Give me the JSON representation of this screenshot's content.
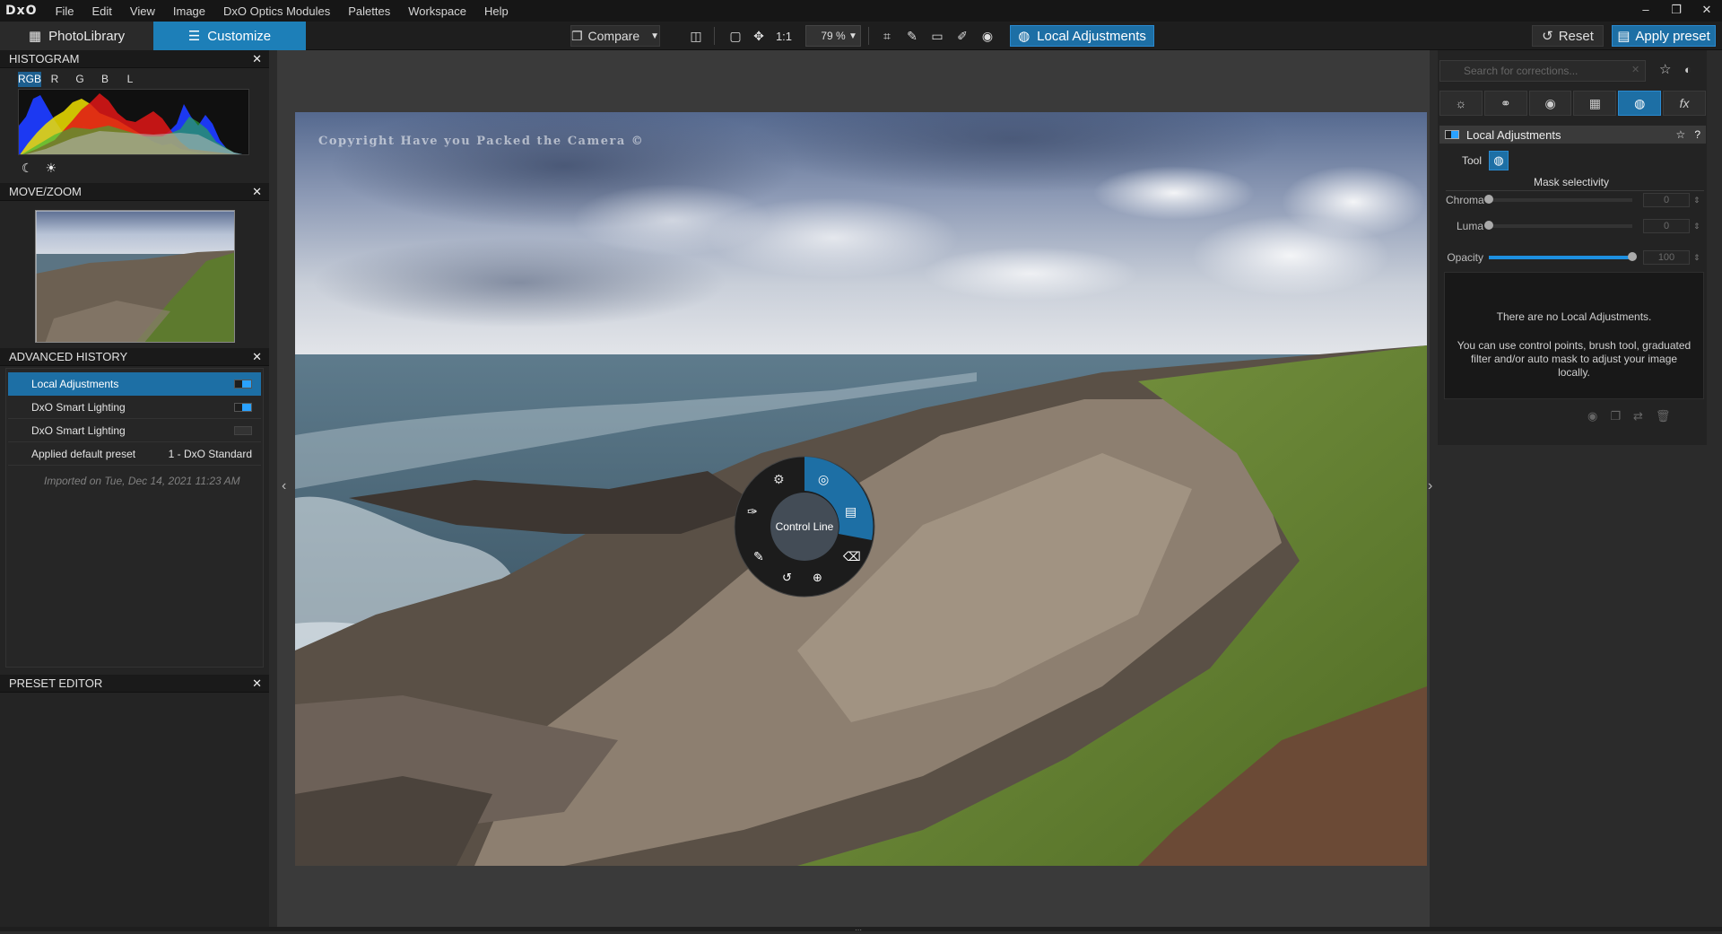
{
  "app": {
    "logo": "DxO"
  },
  "menu": [
    "File",
    "Edit",
    "View",
    "Image",
    "DxO Optics Modules",
    "Palettes",
    "Workspace",
    "Help"
  ],
  "window_controls": [
    "–",
    "❐",
    "✕"
  ],
  "toolbar": {
    "photolibrary_label": "PhotoLibrary",
    "customize_label": "Customize",
    "compare_label": "Compare",
    "one_to_one": "1:1",
    "zoom": "79 %",
    "local_adjustments_label": "Local Adjustments",
    "reset_label": "Reset",
    "apply_preset_label": "Apply preset"
  },
  "histogram": {
    "title": "HISTOGRAM",
    "channels": [
      "RGB",
      "R",
      "G",
      "B",
      "L"
    ],
    "active_channel": "RGB"
  },
  "move_zoom": {
    "title": "MOVE/ZOOM"
  },
  "advanced_history": {
    "title": "ADVANCED HISTORY",
    "items": [
      {
        "label": "Local Adjustments",
        "detail": "",
        "state": "on",
        "active": true
      },
      {
        "label": "DxO Smart Lighting",
        "detail": "",
        "state": "on",
        "active": false
      },
      {
        "label": "DxO Smart Lighting",
        "detail": "",
        "state": "off",
        "active": false
      },
      {
        "label": "Applied default preset",
        "detail": "1 - DxO Standard",
        "state": "none",
        "active": false
      }
    ],
    "imported": "Imported on Tue, Dec 14, 2021 11:23 AM"
  },
  "preset_editor": {
    "title": "PRESET EDITOR"
  },
  "viewer": {
    "copyright": "Copyright Have you Packed the Camera ©",
    "radial_menu_label": "Control Line"
  },
  "right_panel": {
    "search_placeholder": "Search for corrections...",
    "palette_tabs": [
      "sun-icon",
      "color-circles-icon",
      "detail-icon",
      "geometry-icon",
      "local-adjust-icon",
      "fx-icon"
    ],
    "active_tab": "local-adjust-icon",
    "la_title": "Local Adjustments",
    "tool_label": "Tool",
    "mask_selectivity": "Mask selectivity",
    "sliders": [
      {
        "label": "Chroma",
        "value": "0",
        "level": 0
      },
      {
        "label": "Luma",
        "value": "0",
        "level": 0
      },
      {
        "label": "Opacity",
        "value": "100",
        "level": 100
      }
    ],
    "empty_title": "There are no Local Adjustments.",
    "empty_body": "You can use control points, brush tool, graduated filter and/or auto mask to adjust your image locally."
  },
  "colors": {
    "accent": "#1d7fb8",
    "active_blue": "#1d6fa5"
  }
}
